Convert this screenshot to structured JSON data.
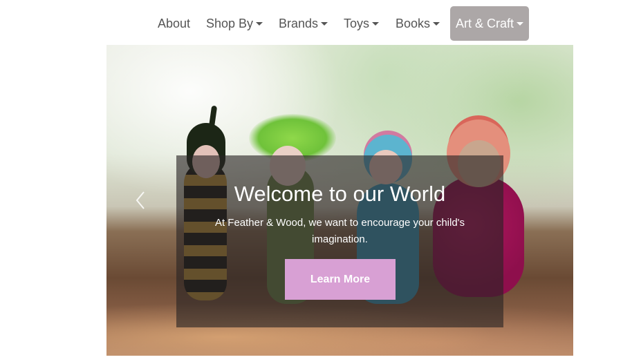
{
  "nav": {
    "items": [
      {
        "label": "About",
        "dropdown": false
      },
      {
        "label": "Shop By",
        "dropdown": true
      },
      {
        "label": "Brands",
        "dropdown": true
      },
      {
        "label": "Toys",
        "dropdown": true
      },
      {
        "label": "Books",
        "dropdown": true
      },
      {
        "label": "Art & Craft",
        "dropdown": true,
        "active": true
      }
    ],
    "active_bg": "#aca7a7",
    "text_color": "#555555"
  },
  "hero": {
    "title": "Welcome to our World",
    "text": "At Feather & Wood, we want to encourage your child's imagination.",
    "button_label": "Learn More",
    "button_color": "#d8a0d4",
    "prev_icon": "chevron-left-icon"
  }
}
